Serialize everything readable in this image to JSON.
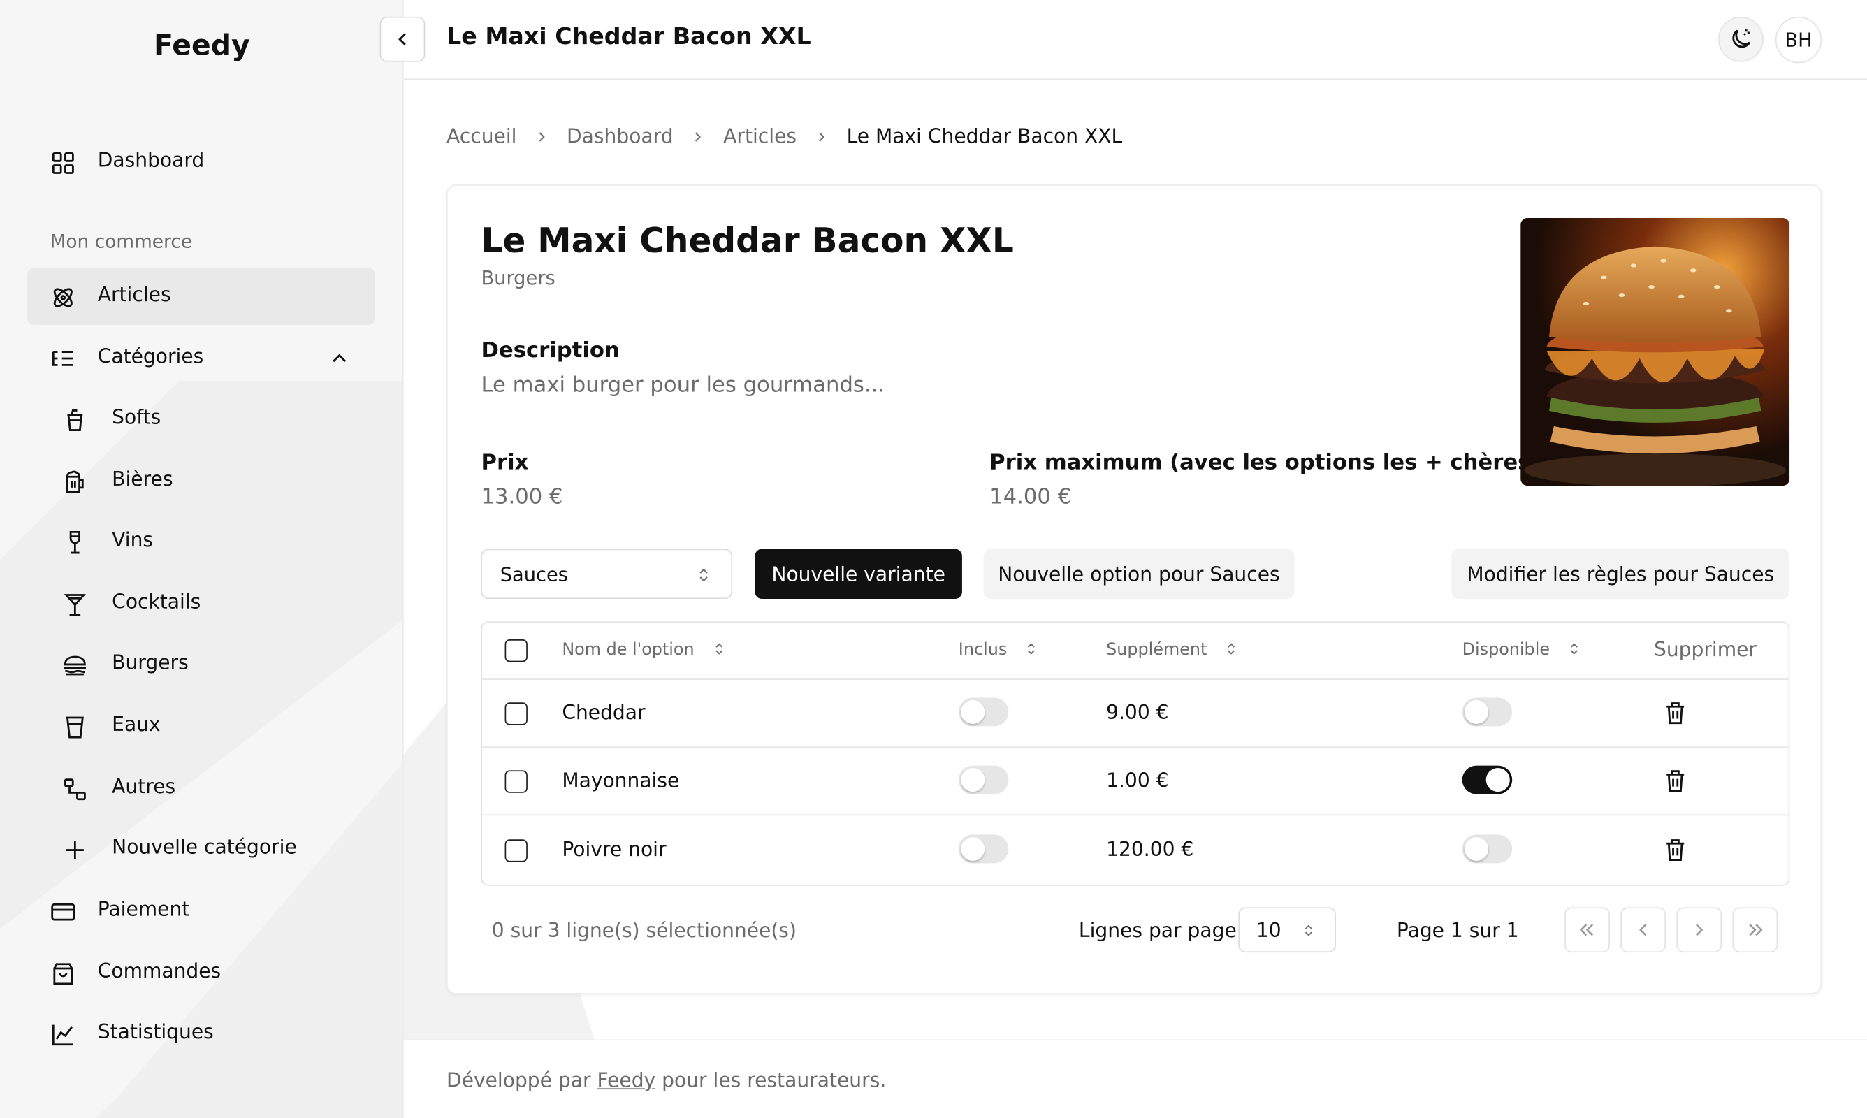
{
  "app": {
    "brand": "Feedy"
  },
  "sidebar": {
    "dashboard": "Dashboard",
    "section_label": "Mon commerce",
    "articles": "Articles",
    "categories": "Catégories",
    "sub_items": [
      {
        "label": "Softs",
        "icon": "cup-icon"
      },
      {
        "label": "Bières",
        "icon": "beer-icon"
      },
      {
        "label": "Vins",
        "icon": "wine-glass-icon"
      },
      {
        "label": "Cocktails",
        "icon": "cocktail-icon"
      },
      {
        "label": "Burgers",
        "icon": "burger-icon"
      },
      {
        "label": "Eaux",
        "icon": "glass-icon"
      },
      {
        "label": "Autres",
        "icon": "shapes-icon"
      },
      {
        "label": "Nouvelle catégorie",
        "icon": "plus-icon"
      }
    ],
    "paiement": "Paiement",
    "commandes": "Commandes",
    "statistiques": "Statistiques"
  },
  "topbar": {
    "title": "Le Maxi Cheddar Bacon XXL",
    "avatar_initials": "BH"
  },
  "breadcrumb": {
    "items": [
      "Accueil",
      "Dashboard",
      "Articles"
    ],
    "current": "Le Maxi Cheddar Bacon XXL"
  },
  "product": {
    "title": "Le Maxi Cheddar Bacon XXL",
    "category": "Burgers",
    "description_label": "Description",
    "description": "Le maxi burger pour les gourmands...",
    "price_label": "Prix",
    "price": "13.00 €",
    "max_price_label": "Prix maximum (avec les options les + chères)",
    "max_price": "14.00 €"
  },
  "options_toolbar": {
    "group_select": "Sauces",
    "new_variant": "Nouvelle variante",
    "new_option": "Nouvelle option pour Sauces",
    "edit_rules": "Modifier les règles pour Sauces"
  },
  "table": {
    "headers": {
      "name": "Nom de l'option",
      "included": "Inclus",
      "supplement": "Supplément",
      "available": "Disponible",
      "delete": "Supprimer"
    },
    "rows": [
      {
        "name": "Cheddar",
        "included": false,
        "supplement": "9.00 €",
        "available": false
      },
      {
        "name": "Mayonnaise",
        "included": false,
        "supplement": "1.00 €",
        "available": true
      },
      {
        "name": "Poivre noir",
        "included": false,
        "supplement": "120.00 €",
        "available": false
      }
    ]
  },
  "pagination": {
    "selection_text": "0 sur 3 ligne(s) sélectionnée(s)",
    "rows_per_page_label": "Lignes par page",
    "rows_per_page": "10",
    "page_text": "Page 1 sur 1"
  },
  "footer": {
    "prefix": "Développé par",
    "link": "Feedy",
    "suffix": "pour les restaurateurs."
  },
  "colors": {
    "primary": "#111111",
    "sidebar_bg": "#f6f6f6",
    "muted_text": "#6b6b6b",
    "border": "#e3e3e3"
  }
}
